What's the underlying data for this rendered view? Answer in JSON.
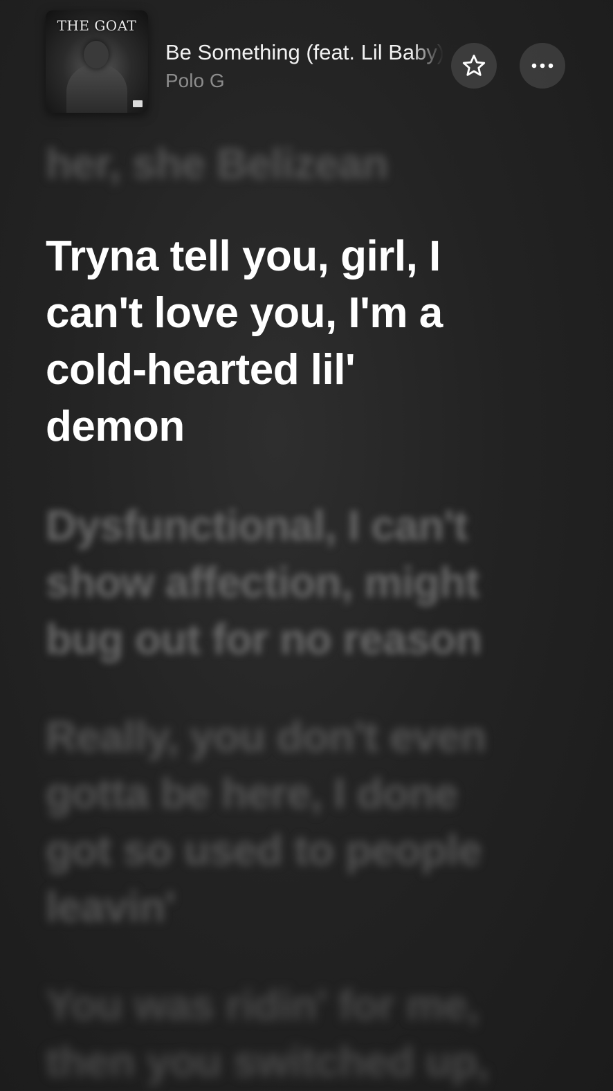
{
  "now_playing": {
    "album_art_text": "THE GOAT",
    "title": "Be Something (feat. Lil Baby)",
    "artist": "Polo G",
    "favorite_icon": "star-icon",
    "more_icon": "ellipsis-icon"
  },
  "lyrics": {
    "previous": "her, she Belizean",
    "current": "Tryna tell you, girl, I can't love you, I'm a cold-hearted lil' demon",
    "next": [
      "Dysfunctional, I can't show affection, might bug out for no reason",
      "Really, you don't even gotta be here, I done got so used to people leavin'",
      "You was ridin' for me, then you switched up,"
    ]
  }
}
